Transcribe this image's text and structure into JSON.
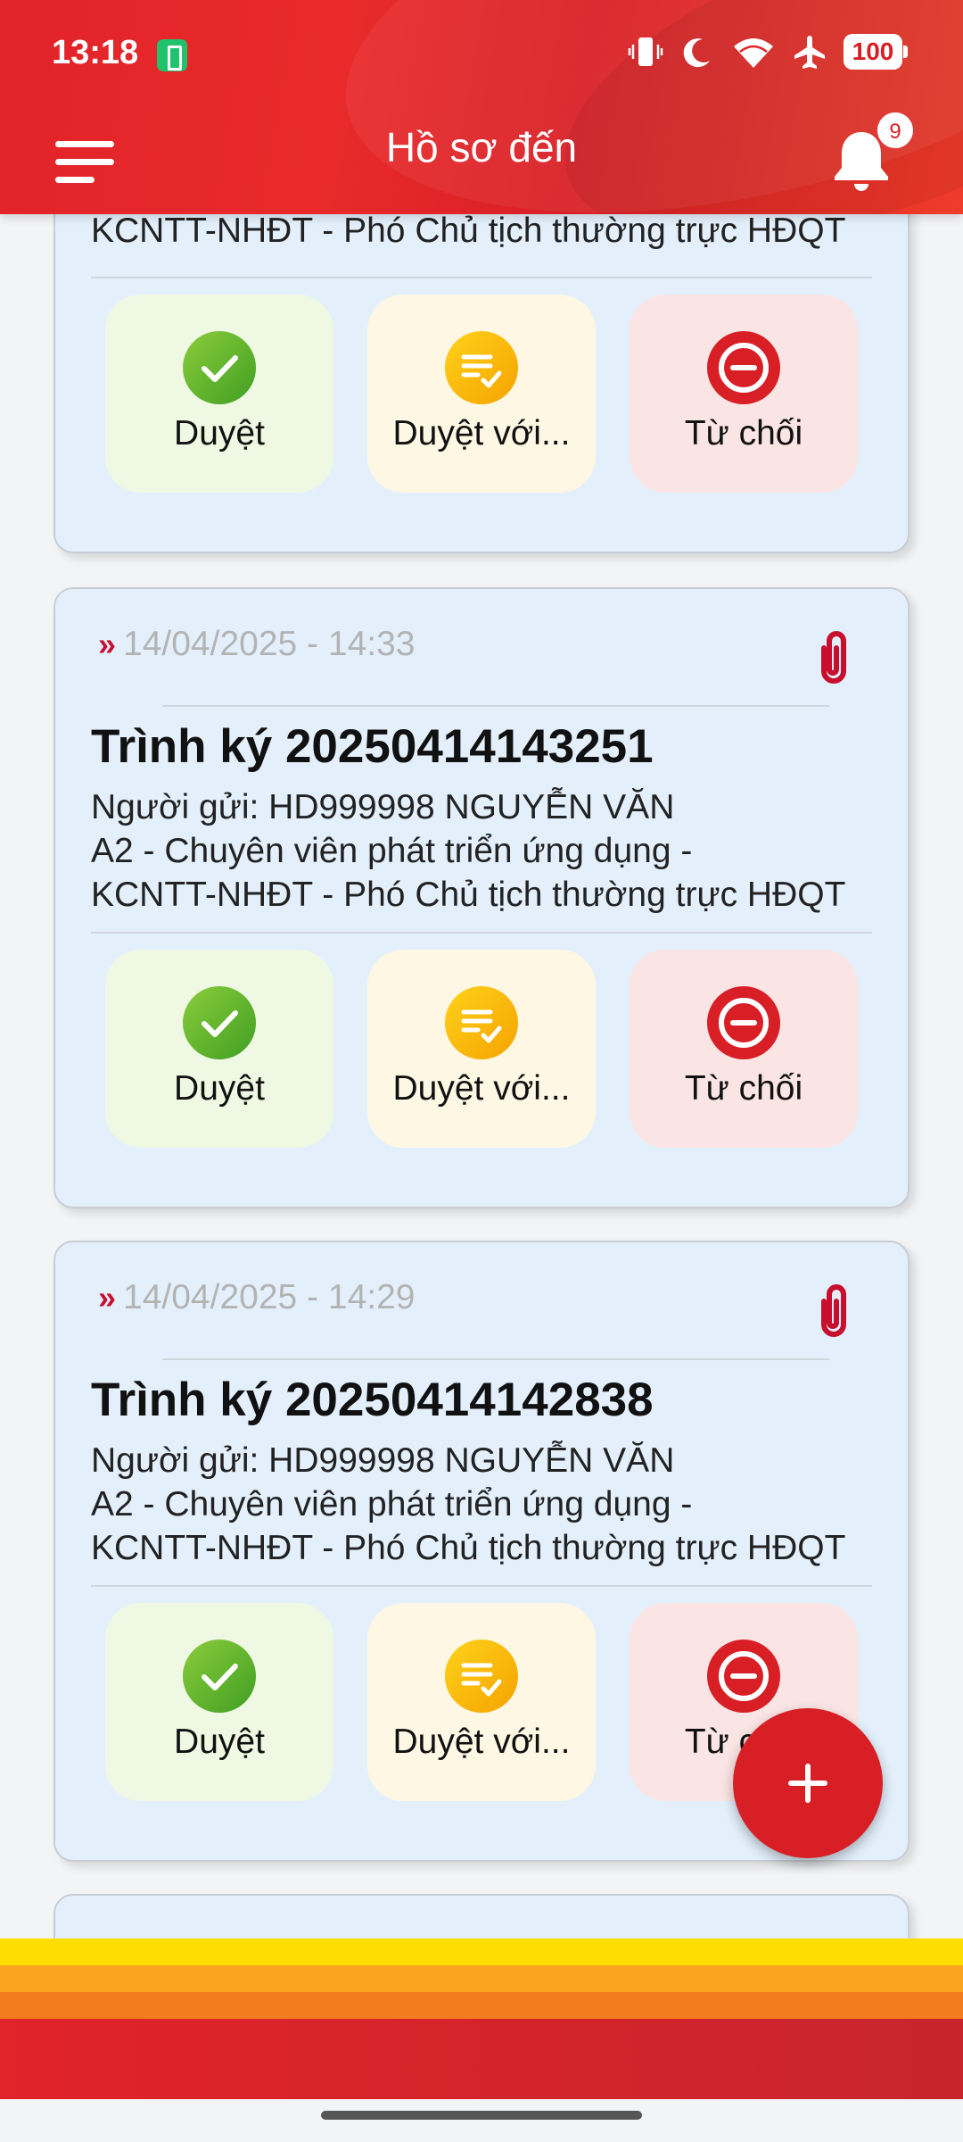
{
  "status_bar": {
    "time": "13:18",
    "battery": "100",
    "icons": [
      "battery-saver-icon",
      "vibrate-icon",
      "moon-icon",
      "wifi-icon",
      "airplane-icon"
    ]
  },
  "header": {
    "title": "Hồ sơ đến",
    "notification_count": "9",
    "color": "#e1232a"
  },
  "actions": {
    "approve": "Duyệt",
    "approve_with": "Duyệt với...",
    "reject": "Từ chối",
    "approve_color": "#4caf2a",
    "approve_with_color": "#f5b800",
    "reject_color": "#d81f26"
  },
  "cards": [
    {
      "sender_tail": "KCNTT-NHĐT - Phó Chủ tịch thường trực HĐQT"
    },
    {
      "date": "14/04/2025 - 14:33",
      "title": "Trình ký 20250414143251",
      "sender_line1": "Người gửi: HD999998 NGUYỄN VĂN",
      "sender_line2": "A2 - Chuyên viên phát triển ứng dụng -",
      "sender_line3": "KCNTT-NHĐT - Phó Chủ tịch thường trực HĐQT"
    },
    {
      "date": "14/04/2025 - 14:29",
      "title": "Trình ký 20250414142838",
      "sender_line1": "Người gửi: HD999998 NGUYỄN VĂN",
      "sender_line2": "A2 - Chuyên viên phát triển ứng dụng -",
      "sender_line3": "KCNTT-NHĐT - Phó Chủ tịch thường trực HĐQT"
    }
  ],
  "fab": {
    "icon": "plus-icon"
  }
}
